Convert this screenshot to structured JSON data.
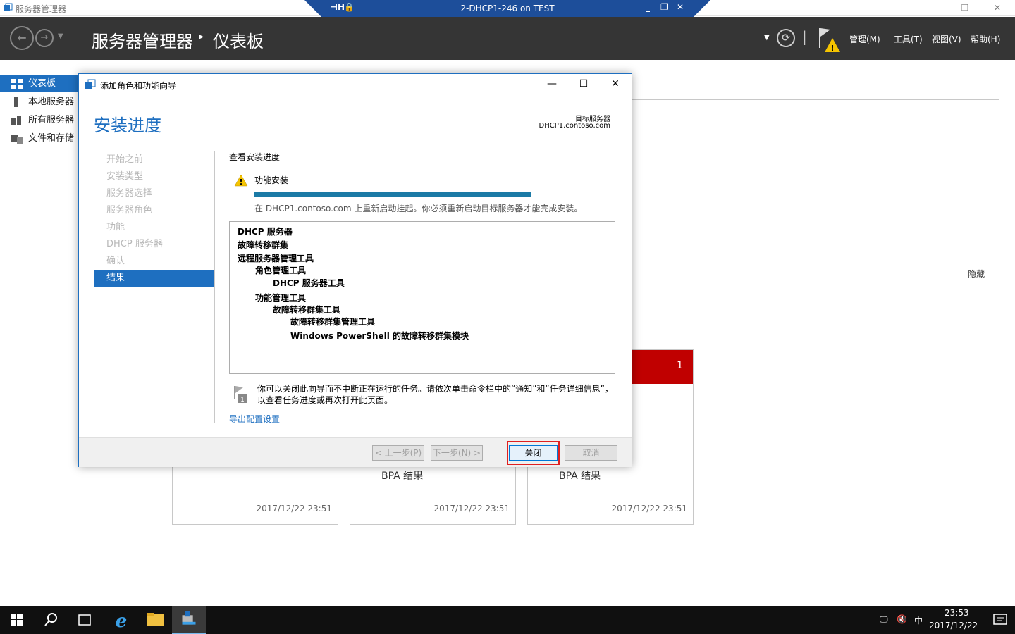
{
  "window": {
    "title": "服务器管理器"
  },
  "rdp": {
    "title": "2-DHCP1-246 on TEST"
  },
  "header": {
    "breadcrumb_root": "服务器管理器",
    "breadcrumb_sep": "▸",
    "breadcrumb_page": "仪表板",
    "menus": [
      "管理(M)",
      "工具(T)",
      "视图(V)",
      "帮助(H)"
    ]
  },
  "leftnav": {
    "items": [
      {
        "label": "仪表板",
        "icon": "dashboard-icon"
      },
      {
        "label": "本地服务器",
        "icon": "server-icon"
      },
      {
        "label": "所有服务器",
        "icon": "servers-icon"
      },
      {
        "label": "文件和存储",
        "icon": "storage-icon"
      }
    ]
  },
  "background": {
    "hide_label": "隐藏",
    "tiles": [
      {
        "bpa": "",
        "timestamp": "2017/12/22 23:51"
      },
      {
        "bpa": "BPA 结果",
        "timestamp": "2017/12/22 23:51"
      },
      {
        "bpa": "BPA 结果",
        "timestamp": "2017/12/22 23:51",
        "alert_count": "1"
      }
    ]
  },
  "wizard": {
    "title": "添加角色和功能向导",
    "heading": "安装进度",
    "target_label": "目标服务器",
    "target_value": "DHCP1.contoso.com",
    "steps": [
      "开始之前",
      "安装类型",
      "服务器选择",
      "服务器角色",
      "功能",
      "DHCP 服务器",
      "确认",
      "结果"
    ],
    "active_step": 7,
    "section_title": "查看安装进度",
    "install_label": "功能安装",
    "progress_fraction": 1.0,
    "progress_message": "在 DHCP1.contoso.com 上重新启动挂起。你必须重新启动目标服务器才能完成安装。",
    "results": [
      "DHCP 服务器",
      "故障转移群集",
      "远程服务器管理工具",
      "角色管理工具",
      "DHCP 服务器工具",
      "功能管理工具",
      "故障转移群集工具",
      "故障转移群集管理工具",
      "Windows PowerShell 的故障转移群集模块"
    ],
    "note": "你可以关闭此向导而不中断正在运行的任务。请依次单击命令栏中的“通知”和“任务详细信息”，以查看任务进度或再次打开此页面。",
    "export_link": "导出配置设置",
    "buttons": {
      "prev": "< 上一步(P)",
      "next": "下一步(N) >",
      "close": "关闭",
      "cancel": "取消"
    }
  },
  "taskbar": {
    "ime": "中",
    "time": "23:53",
    "date": "2017/12/22"
  },
  "colors": {
    "accent": "#1e6fc0",
    "header_bg": "#353535",
    "alert_red": "#c00000"
  }
}
